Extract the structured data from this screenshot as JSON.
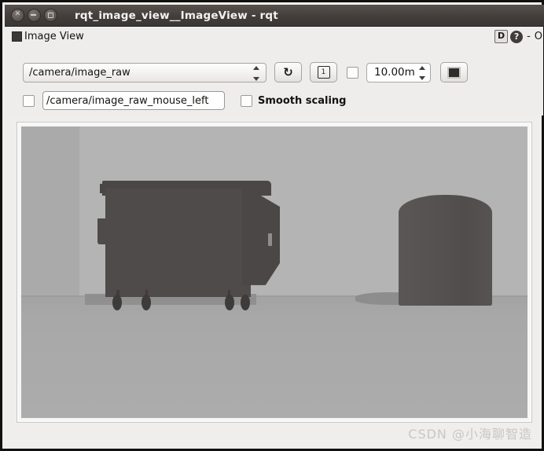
{
  "window": {
    "title": "rqt_image_view__ImageView - rqt",
    "controls": {
      "close": "close-icon",
      "minimize": "minimize-icon",
      "maximize": "maximize-icon"
    }
  },
  "dock": {
    "title": "Image View",
    "icon": "image-view-icon",
    "float_label": "D",
    "help_label": "?",
    "minimize_label": "-",
    "close_label": "O"
  },
  "toolbar": {
    "topic_combo": {
      "value": "/camera/image_raw",
      "options": [
        "/camera/image_raw"
      ]
    },
    "refresh_button": {
      "icon": "refresh-icon",
      "glyph": "↻"
    },
    "save_button": {
      "icon": "save-image-icon",
      "glyph": "1"
    },
    "dynamic_range_checkbox": {
      "checked": false
    },
    "max_range_spinbox": {
      "value": "10.00m"
    },
    "color_scheme_button": {
      "icon": "color-scheme-icon"
    },
    "publish_click_checkbox": {
      "checked": false
    },
    "mouse_topic_field": {
      "value": "/camera/image_raw_mouse_left",
      "placeholder": "/camera/image_raw_mouse_left"
    },
    "smooth_scaling_checkbox": {
      "checked": false,
      "label": "Smooth scaling"
    }
  },
  "viewport": {
    "scene": {
      "description": "grayscale camera view of a simulated scene",
      "objects": [
        {
          "name": "dumpster",
          "tone": "#4e4b4a"
        },
        {
          "name": "cylinder",
          "tone": "#555251"
        },
        {
          "name": "ground-plane",
          "tone": "#a8a8a8"
        },
        {
          "name": "sky-backdrop",
          "tone": "#b4b4b4"
        }
      ]
    }
  },
  "watermark": {
    "text": "CSDN @小海聊智造"
  },
  "colors": {
    "window_border": "#12100f",
    "titlebar": "#433e3b",
    "panel_bg": "#efedeb",
    "text": "#141312"
  }
}
